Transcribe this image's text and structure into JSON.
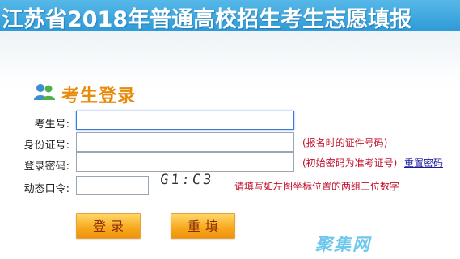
{
  "banner": {
    "title": "江苏省2018年普通高校招生考生志愿填报"
  },
  "login": {
    "title": "考生登录",
    "fields": {
      "exam_no": {
        "label": "考生号:",
        "value": ""
      },
      "id_no": {
        "label": "身份证号:",
        "value": "",
        "hint": "(报名时的证件号码)"
      },
      "password": {
        "label": "登录密码:",
        "value": "",
        "hint": "(初始密码为准考证号)",
        "reset_link": "重置密码"
      },
      "dynamic_code": {
        "label": "动态口令:",
        "value": "",
        "captcha": "G1:C3",
        "hint": "请填写如左图坐标位置的两组三位数字"
      }
    },
    "buttons": {
      "login": "登录",
      "reset": "重填"
    }
  },
  "watermark": "聚集网",
  "colors": {
    "banner": "#2f9bd8",
    "title_accent": "#e88a0c",
    "hint": "#c0102a",
    "button": "#f6a81c"
  },
  "icons": [
    "users-icon"
  ]
}
